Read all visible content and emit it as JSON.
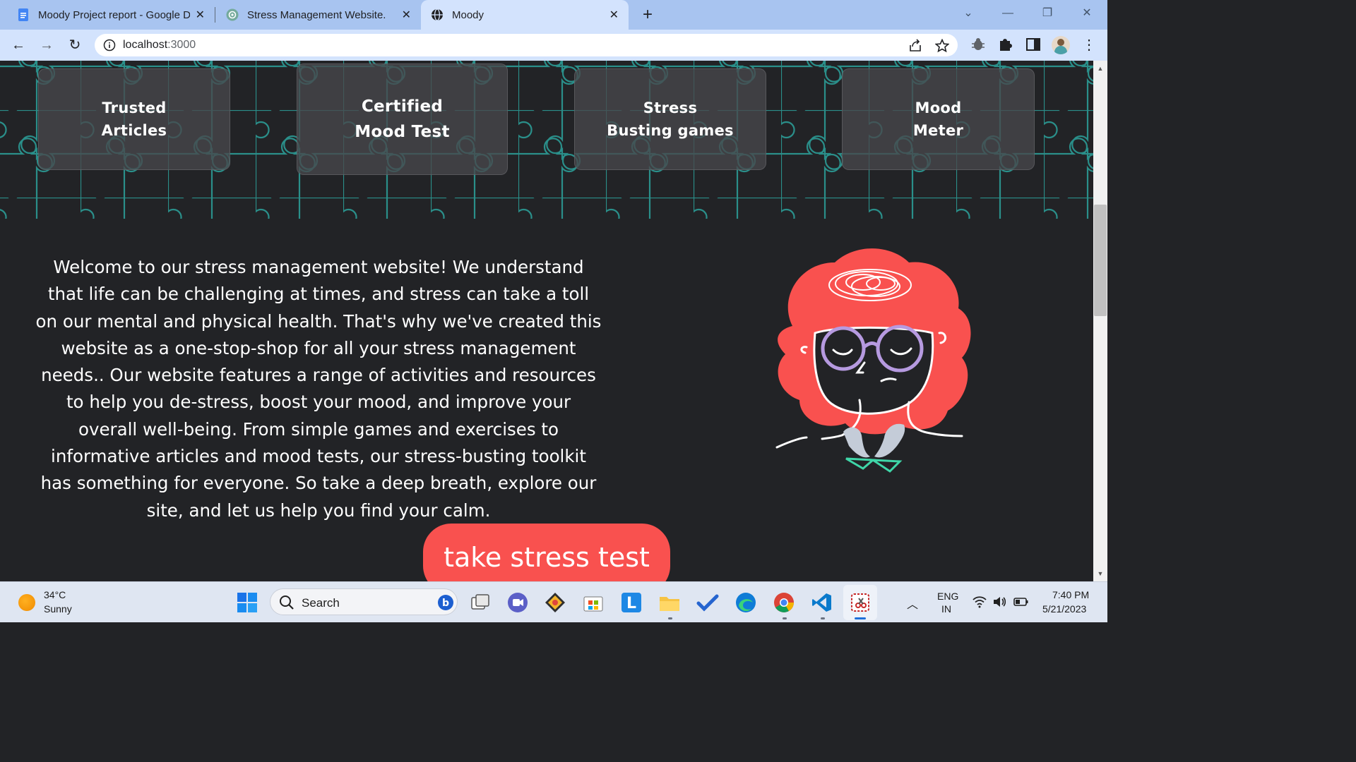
{
  "browser": {
    "tabs": [
      {
        "title": "Moody Project report - Google D",
        "icon": "google-docs-icon",
        "active": false
      },
      {
        "title": "Stress Management Website.",
        "icon": "chatgpt-icon",
        "active": false
      },
      {
        "title": "Moody",
        "icon": "globe-icon",
        "active": true
      }
    ],
    "url_host": "localhost",
    "url_port": ":3000"
  },
  "page": {
    "features": [
      {
        "label": "Trusted\nArticles"
      },
      {
        "label": "Certified\nMood Test"
      },
      {
        "label": "Stress\nBusting games"
      },
      {
        "label": "Mood\nMeter"
      }
    ],
    "welcome_text": "Welcome to our stress management website! We understand that life can be challenging at times, and stress can take a toll on our mental and physical health. That's why we've created this website as a one-stop-shop for all your stress management needs.. Our website features a range of activities and resources to help you de-stress, boost your mood, and improve your overall well-being. From simple games and exercises to informative articles and mood tests, our stress-busting toolkit has something for everyone. So take a deep breath, explore our site, and let us help you find your calm.",
    "cta_label": "take stress test",
    "colors": {
      "background": "#222326",
      "pattern": "#2a8f8a",
      "accent": "#f9514f",
      "card": "#48484c"
    }
  },
  "taskbar": {
    "weather_temp": "34°C",
    "weather_condition": "Sunny",
    "search_label": "Search",
    "lang_line1": "ENG",
    "lang_line2": "IN",
    "time": "7:40 PM",
    "date": "5/21/2023"
  }
}
